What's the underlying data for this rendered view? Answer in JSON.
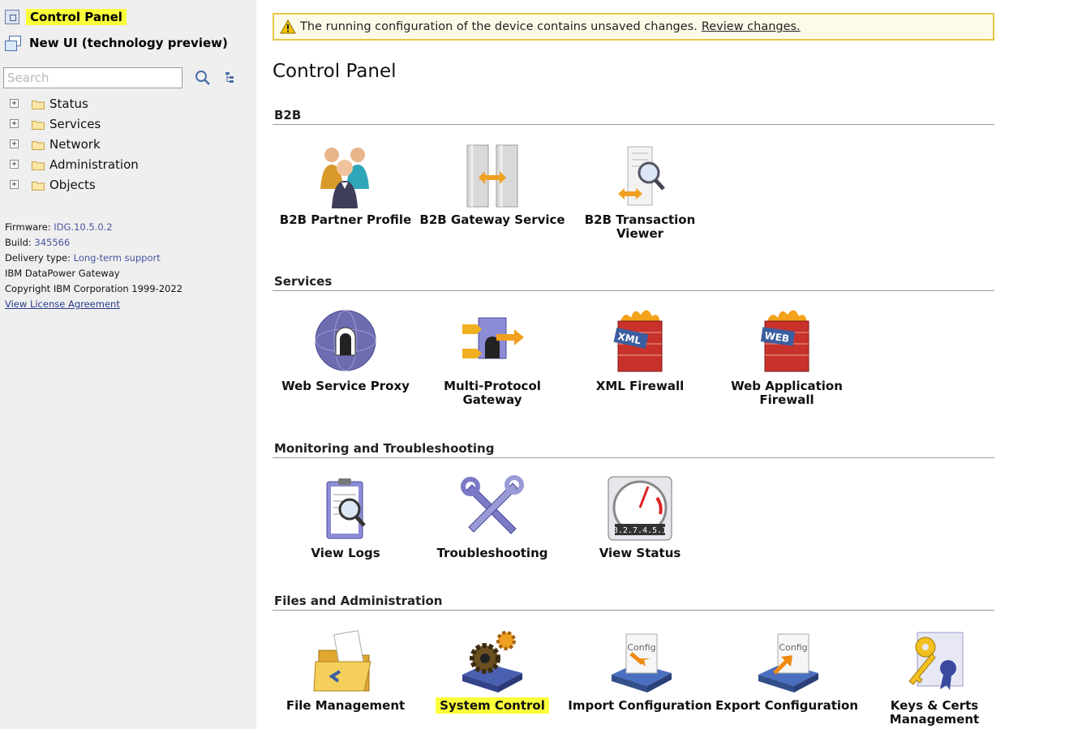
{
  "sidebar": {
    "control_panel": "Control Panel",
    "new_ui": "New UI (technology preview)",
    "search_placeholder": "Search",
    "tree": [
      {
        "label": "Status"
      },
      {
        "label": "Services"
      },
      {
        "label": "Network"
      },
      {
        "label": "Administration"
      },
      {
        "label": "Objects"
      }
    ],
    "info": {
      "firmware_label": "Firmware:",
      "firmware_value": "IDG.10.5.0.2",
      "build_label": "Build:",
      "build_value": "345566",
      "delivery_label": "Delivery type:",
      "delivery_value": "Long-term support",
      "product": "IBM DataPower Gateway",
      "copyright": "Copyright IBM Corporation 1999-2022",
      "license_link": "View License Agreement"
    }
  },
  "banner": {
    "text": "The running configuration of the device contains unsaved changes.",
    "link": "Review changes."
  },
  "page_title": "Control Panel",
  "sections": {
    "b2b": {
      "title": "B2B",
      "tiles": [
        "B2B Partner Profile",
        "B2B Gateway Service",
        "B2B Transaction Viewer"
      ]
    },
    "services": {
      "title": "Services",
      "tiles": [
        "Web Service Proxy",
        "Multi-Protocol Gateway",
        "XML Firewall",
        "Web Application Firewall"
      ]
    },
    "monitoring": {
      "title": "Monitoring and Troubleshooting",
      "tiles": [
        "View Logs",
        "Troubleshooting",
        "View Status"
      ]
    },
    "files": {
      "title": "Files and Administration",
      "tiles": [
        "File Management",
        "System Control",
        "Import Configuration",
        "Export Configuration",
        "Keys & Certs Management"
      ]
    }
  },
  "icon_text": {
    "xml_badge": "XML",
    "web_badge": "WEB",
    "config_badge": "Config",
    "odometer": "3.2.7.4.5.1"
  },
  "colors": {
    "highlight": "#fbff3a",
    "banner_border": "#e7c64a",
    "sidebar_bg": "#efefef",
    "link_blue": "#4a55a0"
  }
}
